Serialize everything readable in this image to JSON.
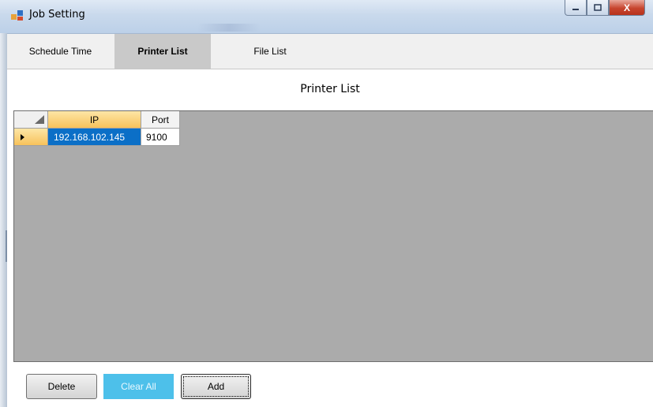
{
  "window": {
    "title": "Job Setting"
  },
  "tabs": [
    {
      "label": "Schedule Time",
      "active": false
    },
    {
      "label": "Printer List",
      "active": true
    },
    {
      "label": "File List",
      "active": false
    }
  ],
  "section": {
    "heading": "Printer List"
  },
  "grid": {
    "columns": [
      "IP",
      "Port"
    ],
    "rows": [
      {
        "ip": "192.168.102.145",
        "port": "9100",
        "selected": true
      }
    ]
  },
  "buttons": {
    "delete": "Delete",
    "clear_all": "Clear All",
    "add": "Add"
  },
  "caption_buttons": {
    "close": "X"
  },
  "colors": {
    "selected_cell": "#0b6fc7",
    "clear_all_button": "#4dc0ea",
    "header_highlight": "#f7c25b"
  }
}
